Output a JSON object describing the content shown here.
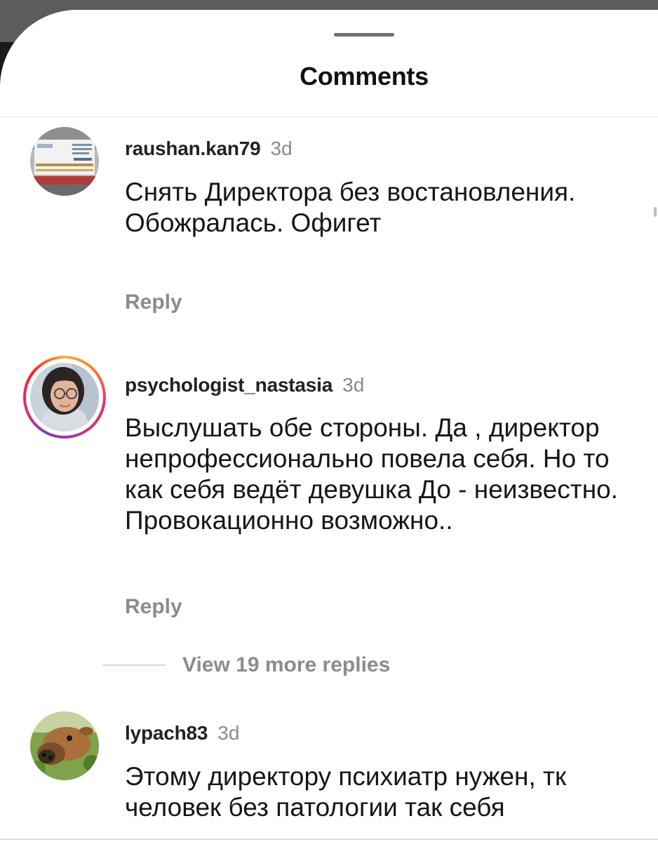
{
  "sheet": {
    "title": "Comments"
  },
  "comments": [
    {
      "username": "raushan.kan79",
      "time": "3d",
      "text": "Снять Директора без востановления. Обожралась. Офигет",
      "reply_label": "Reply",
      "avatar_icon": "document-photo-avatar"
    },
    {
      "username": "psychologist_nastasia",
      "time": "3d",
      "text": "Выслушать обе стороны. Да , директор непрофессионально повела себя. Но то как себя ведёт девушка До - неизвестно. Провокационно возможно..",
      "reply_label": "Reply",
      "avatar_icon": "woman-portrait-avatar",
      "story_ring": true
    },
    {
      "username": "lypach83",
      "time": "3d",
      "text": "Этому директору психиатр нужен, тк человек без патологии так себя",
      "avatar_icon": "cow-photo-avatar"
    }
  ],
  "view_more": {
    "label": "View 19 more replies"
  },
  "colors": {
    "sheet_background": "#ffffff",
    "secondary_text": "#8c8c8c",
    "primary_text": "#161616"
  }
}
